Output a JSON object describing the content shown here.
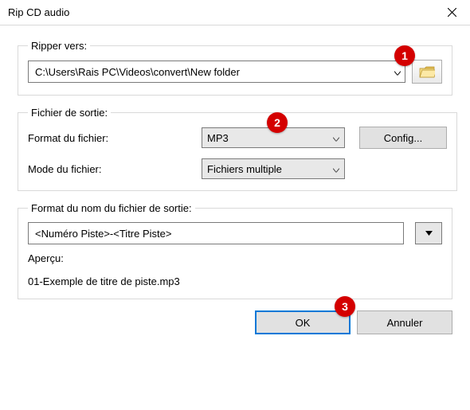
{
  "window": {
    "title": "Rip CD audio"
  },
  "ripper": {
    "legend": "Ripper vers:",
    "path": "C:\\Users\\Rais PC\\Videos\\convert\\New folder"
  },
  "output": {
    "legend": "Fichier de sortie:",
    "format_label": "Format du fichier:",
    "format_value": "MP3",
    "config_label": "Config...",
    "mode_label": "Mode du fichier:",
    "mode_value": "Fichiers multiple"
  },
  "filename": {
    "legend": "Format du nom du fichier de sortie:",
    "pattern": "<Numéro Piste>-<Titre Piste>",
    "preview_label": "Aperçu:",
    "preview_value": "01-Exemple de titre de piste.mp3"
  },
  "buttons": {
    "ok": "OK",
    "cancel": "Annuler"
  },
  "annotations": {
    "b1": "1",
    "b2": "2",
    "b3": "3"
  }
}
